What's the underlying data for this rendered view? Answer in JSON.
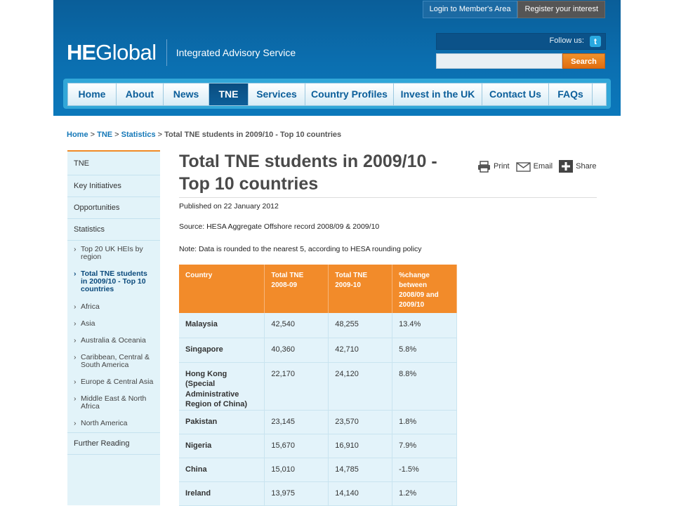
{
  "header": {
    "top_links": [
      "Login to Member's Area",
      "Register your interest"
    ],
    "logo_he": "HE",
    "logo_global": "Global",
    "tagline": "Integrated Advisory Service",
    "follow_label": "Follow us:",
    "twitter_glyph": "t",
    "search_value": "",
    "search_button": "Search"
  },
  "nav": {
    "items": [
      "Home",
      "About",
      "News",
      "TNE",
      "Services",
      "Country Profiles",
      "Invest in the UK",
      "Contact Us",
      "FAQs"
    ],
    "active": "TNE"
  },
  "breadcrumb": {
    "home": "Home",
    "tne": "TNE",
    "stats": "Statistics",
    "sep": " > ",
    "current": "Total TNE students in 2009/10 - Top 10 countries"
  },
  "sidebar": {
    "tne": "TNE",
    "key": "Key Initiatives",
    "opps": "Opportunities",
    "stats": "Statistics",
    "subs": [
      "Top 20 UK HEIs by region",
      "Total TNE students in 2009/10 - Top 10 countries",
      "Africa",
      "Asia",
      "Australia & Oceania",
      "Caribbean, Central & South America",
      "Europe & Central Asia",
      "Middle East & North Africa",
      "North America"
    ],
    "further": "Further Reading"
  },
  "article": {
    "title": "Total TNE students in 2009/10 - Top 10 countries",
    "print": "Print",
    "email": "Email",
    "share": "Share",
    "published": "Published on 22 January 2012",
    "source": "Source: HESA Aggregate Offshore record 2008/09 & 2009/10",
    "note": "Note: Data is rounded to the nearest 5, according to HESA rounding policy"
  },
  "table": {
    "headers": [
      "Country",
      "Total TNE 2008-09",
      "Total TNE 2009-10",
      "%change between 2008/09 and 2009/10"
    ],
    "rows": [
      [
        "Malaysia",
        "42,540",
        "48,255",
        "13.4%"
      ],
      [
        "Singapore",
        "40,360",
        "42,710",
        "5.8%"
      ],
      [
        "Hong Kong (Special Administrative Region of China)",
        "22,170",
        "24,120",
        "8.8%"
      ],
      [
        "Pakistan",
        "23,145",
        "23,570",
        "1.8%"
      ],
      [
        "Nigeria",
        "15,670",
        "16,910",
        "7.9%"
      ],
      [
        "China",
        "15,010",
        "14,785",
        "-1.5%"
      ],
      [
        "Ireland",
        "13,975",
        "14,140",
        "1.2%"
      ]
    ]
  }
}
